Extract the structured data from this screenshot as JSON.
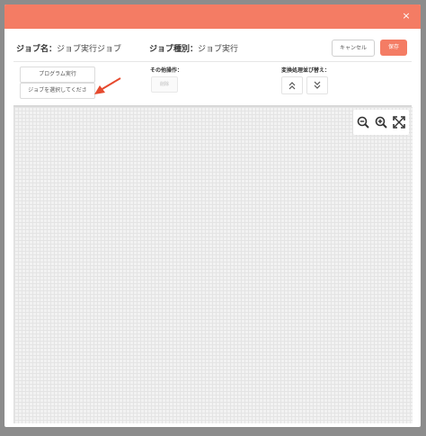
{
  "modal": {
    "close_glyph": "×"
  },
  "header": {
    "job_name_label": "ジョブ名：",
    "job_name_value": "ジョブ実行ジョブ",
    "job_type_label": "ジョブ種別：",
    "job_type_value": "ジョブ実行",
    "cancel_label": "キャンセル",
    "save_label": "保存"
  },
  "toolbar": {
    "program_button": "プログラム実行",
    "job_select_placeholder": "ジョブを選択してくださ",
    "other_ops_label": "その他操作：",
    "delete_label": "削除",
    "sort_label": "変換処理並び替え："
  },
  "icons": {
    "close": "close-icon",
    "arrow": "red-arrow-annotation-icon",
    "sort_up": "chevron-double-up-icon",
    "sort_down": "chevron-double-down-icon",
    "zoom_out": "zoom-out-icon",
    "zoom_in": "zoom-in-icon",
    "fit": "expand-icon"
  },
  "colors": {
    "accent": "#f47c64",
    "arrow": "#e64a2e",
    "canvas_bg": "#f2f2f2"
  }
}
